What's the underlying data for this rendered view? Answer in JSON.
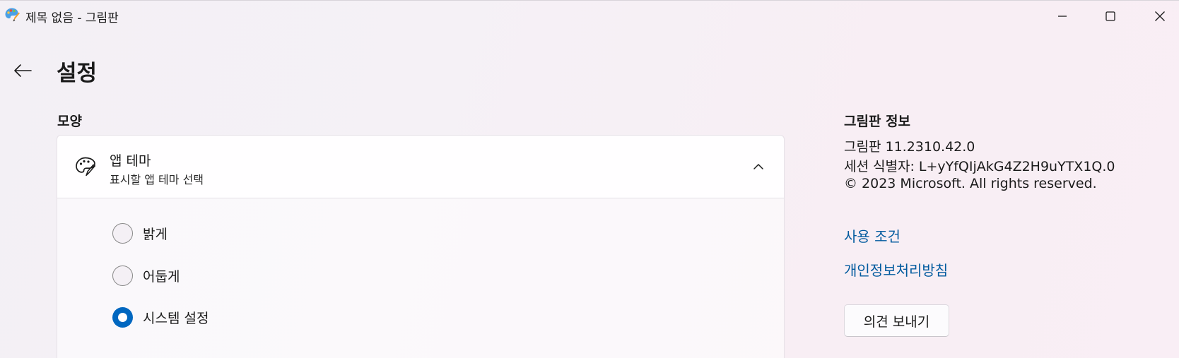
{
  "window": {
    "title": "제목 없음 - 그림판",
    "app_icon": "paint-palette-icon",
    "controls": [
      "minimize-icon",
      "maximize-icon",
      "close-icon"
    ]
  },
  "header": {
    "back_icon": "arrow-left-icon",
    "title": "설정"
  },
  "appearance": {
    "section_label": "모양",
    "theme_card": {
      "icon": "palette-icon",
      "title": "앱 테마",
      "subtitle": "표시할 앱 테마 선택",
      "expanded_icon": "chevron-up-icon",
      "options": [
        {
          "label": "밝게",
          "selected": false
        },
        {
          "label": "어둡게",
          "selected": false
        },
        {
          "label": "시스템 설정",
          "selected": true
        }
      ]
    }
  },
  "about": {
    "title": "그림판 정보",
    "version": "그림판 11.2310.42.0",
    "session_id": "세션 식별자: L+yYfQIjAkG4Z2H9uYTX1Q.0",
    "copyright": "© 2023 Microsoft. All rights reserved.",
    "terms_link": "사용 조건",
    "privacy_link": "개인정보처리방침",
    "feedback_button": "의견 보내기"
  },
  "colors": {
    "accent": "#0067c0",
    "link": "#005a9e"
  }
}
